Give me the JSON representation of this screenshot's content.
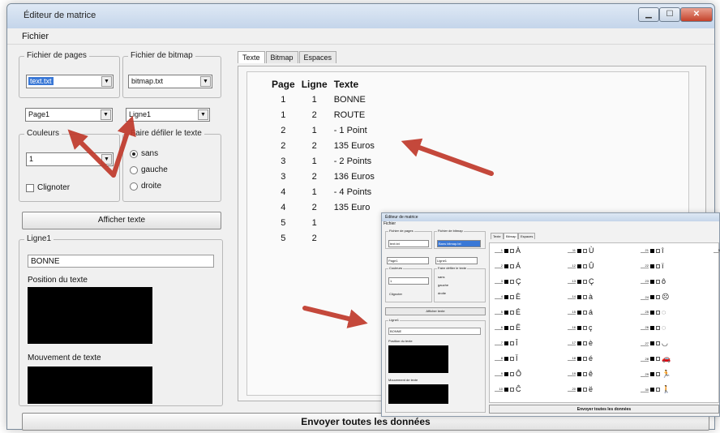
{
  "window": {
    "title": "Éditeur de matrice",
    "menu": "Fichier"
  },
  "left": {
    "pages_file": {
      "label": "Fichier de pages",
      "value": "text.txt"
    },
    "bitmap_file": {
      "label": "Fichier de bitmap",
      "value": "bitmap.txt"
    },
    "page_select": "Page1",
    "line_select": "Ligne1",
    "colors": {
      "label": "Couleurs",
      "value": "1",
      "blink": "Clignoter"
    },
    "scroll": {
      "label": "Faire défiler le texte",
      "options": [
        "sans",
        "gauche",
        "droite"
      ]
    },
    "show_text_button": "Afficher texte",
    "line_group": {
      "label": "Ligne1",
      "value": "BONNE",
      "position_label": "Position du texte",
      "movement_label": "Mouvement de texte"
    }
  },
  "tabs": [
    "Texte",
    "Bitmap",
    "Espaces"
  ],
  "text_table": {
    "headers": [
      "Page",
      "Ligne",
      "Texte"
    ],
    "rows": [
      [
        "1",
        "1",
        "BONNE"
      ],
      [
        "1",
        "2",
        "ROUTE"
      ],
      [
        "2",
        "1",
        "- 1 Point"
      ],
      [
        "2",
        "2",
        "135 Euros"
      ],
      [
        "3",
        "1",
        "- 2 Points"
      ],
      [
        "3",
        "2",
        "136 Euros"
      ],
      [
        "4",
        "1",
        "- 4 Points"
      ],
      [
        "4",
        "2",
        "135 Euro"
      ],
      [
        "5",
        "1",
        ""
      ],
      [
        "5",
        "2",
        ""
      ]
    ]
  },
  "send_button": "Envoyer toutes les données",
  "overlay": {
    "title": "Éditeur de matrice",
    "menu": "Fichier",
    "pages_file_label": "Fichier de pages",
    "pages_file_value": "text.txt",
    "bitmap_file_label": "Fichier de bitmap",
    "bitmap_file_value": "Bans bitmap.txt",
    "page_select": "Page1",
    "line_select": "Ligne1",
    "colors_label": "Couleurs",
    "colors_value": "1",
    "blink": "Clignoter",
    "scroll_label": "Faire défiler le texte",
    "scroll_options": [
      "sans",
      "gauche",
      "droite"
    ],
    "show_text_button": "Afficher texte",
    "line_label": "Ligne1",
    "line_value": "BONNE",
    "position_label": "Position du texte",
    "movement_label": "Mouvement de texte",
    "tabs": [
      "Texte",
      "Bitmap",
      "Espaces"
    ],
    "cells": [
      {
        "n": "1",
        "ch": "À"
      },
      {
        "n": "2",
        "ch": "Á"
      },
      {
        "n": "3",
        "ch": "Ç"
      },
      {
        "n": "4",
        "ch": "È"
      },
      {
        "n": "5",
        "ch": "É"
      },
      {
        "n": "6",
        "ch": "Ë"
      },
      {
        "n": "7",
        "ch": "Î"
      },
      {
        "n": "8",
        "ch": "Ï"
      },
      {
        "n": "9",
        "ch": "Ô"
      },
      {
        "n": "10",
        "ch": "Ĉ"
      },
      {
        "n": "11",
        "ch": "Ù"
      },
      {
        "n": "12",
        "ch": "Û"
      },
      {
        "n": "13",
        "ch": "Ç"
      },
      {
        "n": "14",
        "ch": "à"
      },
      {
        "n": "15",
        "ch": "á"
      },
      {
        "n": "16",
        "ch": "ç"
      },
      {
        "n": "17",
        "ch": "è"
      },
      {
        "n": "18",
        "ch": "é"
      },
      {
        "n": "19",
        "ch": "ê"
      },
      {
        "n": "20",
        "ch": "ë"
      },
      {
        "n": "21",
        "ch": "î"
      },
      {
        "n": "22",
        "ch": "ï"
      },
      {
        "n": "23",
        "ch": "ô"
      },
      {
        "n": "24",
        "ch": "☹"
      },
      {
        "n": "25",
        "ch": "◌"
      },
      {
        "n": "26",
        "ch": "◌"
      },
      {
        "n": "27",
        "ch": "◡"
      },
      {
        "n": "28",
        "ch": "🚗"
      },
      {
        "n": "29",
        "ch": "🏃"
      },
      {
        "n": "30",
        "ch": "🚶"
      },
      {
        "n": "31",
        "ch": "☺"
      }
    ],
    "send_button": "Envoyer toutes les données"
  }
}
